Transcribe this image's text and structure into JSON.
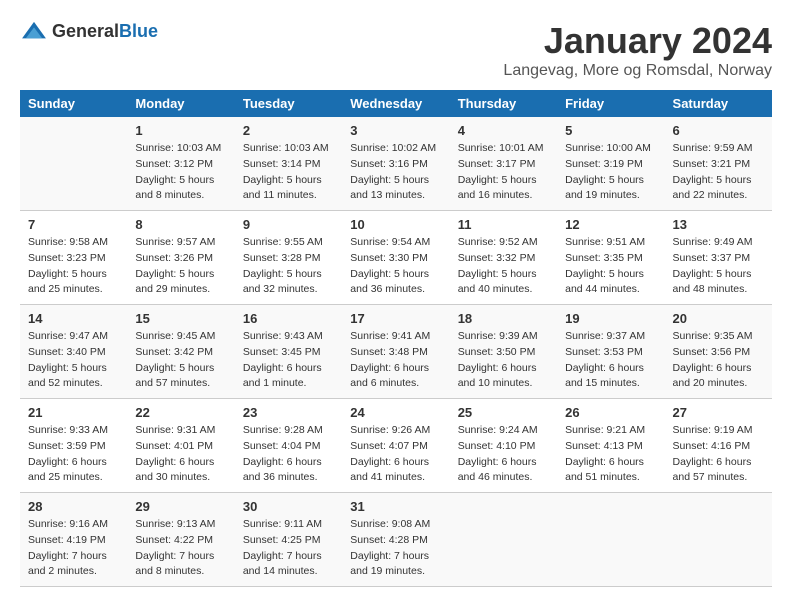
{
  "logo": {
    "general": "General",
    "blue": "Blue"
  },
  "title": "January 2024",
  "location": "Langevag, More og Romsdal, Norway",
  "header": {
    "days": [
      "Sunday",
      "Monday",
      "Tuesday",
      "Wednesday",
      "Thursday",
      "Friday",
      "Saturday"
    ]
  },
  "weeks": [
    [
      {
        "day": "",
        "sunrise": "",
        "sunset": "",
        "daylight": ""
      },
      {
        "day": "1",
        "sunrise": "Sunrise: 10:03 AM",
        "sunset": "Sunset: 3:12 PM",
        "daylight": "Daylight: 5 hours and 8 minutes."
      },
      {
        "day": "2",
        "sunrise": "Sunrise: 10:03 AM",
        "sunset": "Sunset: 3:14 PM",
        "daylight": "Daylight: 5 hours and 11 minutes."
      },
      {
        "day": "3",
        "sunrise": "Sunrise: 10:02 AM",
        "sunset": "Sunset: 3:16 PM",
        "daylight": "Daylight: 5 hours and 13 minutes."
      },
      {
        "day": "4",
        "sunrise": "Sunrise: 10:01 AM",
        "sunset": "Sunset: 3:17 PM",
        "daylight": "Daylight: 5 hours and 16 minutes."
      },
      {
        "day": "5",
        "sunrise": "Sunrise: 10:00 AM",
        "sunset": "Sunset: 3:19 PM",
        "daylight": "Daylight: 5 hours and 19 minutes."
      },
      {
        "day": "6",
        "sunrise": "Sunrise: 9:59 AM",
        "sunset": "Sunset: 3:21 PM",
        "daylight": "Daylight: 5 hours and 22 minutes."
      }
    ],
    [
      {
        "day": "7",
        "sunrise": "Sunrise: 9:58 AM",
        "sunset": "Sunset: 3:23 PM",
        "daylight": "Daylight: 5 hours and 25 minutes."
      },
      {
        "day": "8",
        "sunrise": "Sunrise: 9:57 AM",
        "sunset": "Sunset: 3:26 PM",
        "daylight": "Daylight: 5 hours and 29 minutes."
      },
      {
        "day": "9",
        "sunrise": "Sunrise: 9:55 AM",
        "sunset": "Sunset: 3:28 PM",
        "daylight": "Daylight: 5 hours and 32 minutes."
      },
      {
        "day": "10",
        "sunrise": "Sunrise: 9:54 AM",
        "sunset": "Sunset: 3:30 PM",
        "daylight": "Daylight: 5 hours and 36 minutes."
      },
      {
        "day": "11",
        "sunrise": "Sunrise: 9:52 AM",
        "sunset": "Sunset: 3:32 PM",
        "daylight": "Daylight: 5 hours and 40 minutes."
      },
      {
        "day": "12",
        "sunrise": "Sunrise: 9:51 AM",
        "sunset": "Sunset: 3:35 PM",
        "daylight": "Daylight: 5 hours and 44 minutes."
      },
      {
        "day": "13",
        "sunrise": "Sunrise: 9:49 AM",
        "sunset": "Sunset: 3:37 PM",
        "daylight": "Daylight: 5 hours and 48 minutes."
      }
    ],
    [
      {
        "day": "14",
        "sunrise": "Sunrise: 9:47 AM",
        "sunset": "Sunset: 3:40 PM",
        "daylight": "Daylight: 5 hours and 52 minutes."
      },
      {
        "day": "15",
        "sunrise": "Sunrise: 9:45 AM",
        "sunset": "Sunset: 3:42 PM",
        "daylight": "Daylight: 5 hours and 57 minutes."
      },
      {
        "day": "16",
        "sunrise": "Sunrise: 9:43 AM",
        "sunset": "Sunset: 3:45 PM",
        "daylight": "Daylight: 6 hours and 1 minute."
      },
      {
        "day": "17",
        "sunrise": "Sunrise: 9:41 AM",
        "sunset": "Sunset: 3:48 PM",
        "daylight": "Daylight: 6 hours and 6 minutes."
      },
      {
        "day": "18",
        "sunrise": "Sunrise: 9:39 AM",
        "sunset": "Sunset: 3:50 PM",
        "daylight": "Daylight: 6 hours and 10 minutes."
      },
      {
        "day": "19",
        "sunrise": "Sunrise: 9:37 AM",
        "sunset": "Sunset: 3:53 PM",
        "daylight": "Daylight: 6 hours and 15 minutes."
      },
      {
        "day": "20",
        "sunrise": "Sunrise: 9:35 AM",
        "sunset": "Sunset: 3:56 PM",
        "daylight": "Daylight: 6 hours and 20 minutes."
      }
    ],
    [
      {
        "day": "21",
        "sunrise": "Sunrise: 9:33 AM",
        "sunset": "Sunset: 3:59 PM",
        "daylight": "Daylight: 6 hours and 25 minutes."
      },
      {
        "day": "22",
        "sunrise": "Sunrise: 9:31 AM",
        "sunset": "Sunset: 4:01 PM",
        "daylight": "Daylight: 6 hours and 30 minutes."
      },
      {
        "day": "23",
        "sunrise": "Sunrise: 9:28 AM",
        "sunset": "Sunset: 4:04 PM",
        "daylight": "Daylight: 6 hours and 36 minutes."
      },
      {
        "day": "24",
        "sunrise": "Sunrise: 9:26 AM",
        "sunset": "Sunset: 4:07 PM",
        "daylight": "Daylight: 6 hours and 41 minutes."
      },
      {
        "day": "25",
        "sunrise": "Sunrise: 9:24 AM",
        "sunset": "Sunset: 4:10 PM",
        "daylight": "Daylight: 6 hours and 46 minutes."
      },
      {
        "day": "26",
        "sunrise": "Sunrise: 9:21 AM",
        "sunset": "Sunset: 4:13 PM",
        "daylight": "Daylight: 6 hours and 51 minutes."
      },
      {
        "day": "27",
        "sunrise": "Sunrise: 9:19 AM",
        "sunset": "Sunset: 4:16 PM",
        "daylight": "Daylight: 6 hours and 57 minutes."
      }
    ],
    [
      {
        "day": "28",
        "sunrise": "Sunrise: 9:16 AM",
        "sunset": "Sunset: 4:19 PM",
        "daylight": "Daylight: 7 hours and 2 minutes."
      },
      {
        "day": "29",
        "sunrise": "Sunrise: 9:13 AM",
        "sunset": "Sunset: 4:22 PM",
        "daylight": "Daylight: 7 hours and 8 minutes."
      },
      {
        "day": "30",
        "sunrise": "Sunrise: 9:11 AM",
        "sunset": "Sunset: 4:25 PM",
        "daylight": "Daylight: 7 hours and 14 minutes."
      },
      {
        "day": "31",
        "sunrise": "Sunrise: 9:08 AM",
        "sunset": "Sunset: 4:28 PM",
        "daylight": "Daylight: 7 hours and 19 minutes."
      },
      {
        "day": "",
        "sunrise": "",
        "sunset": "",
        "daylight": ""
      },
      {
        "day": "",
        "sunrise": "",
        "sunset": "",
        "daylight": ""
      },
      {
        "day": "",
        "sunrise": "",
        "sunset": "",
        "daylight": ""
      }
    ]
  ]
}
